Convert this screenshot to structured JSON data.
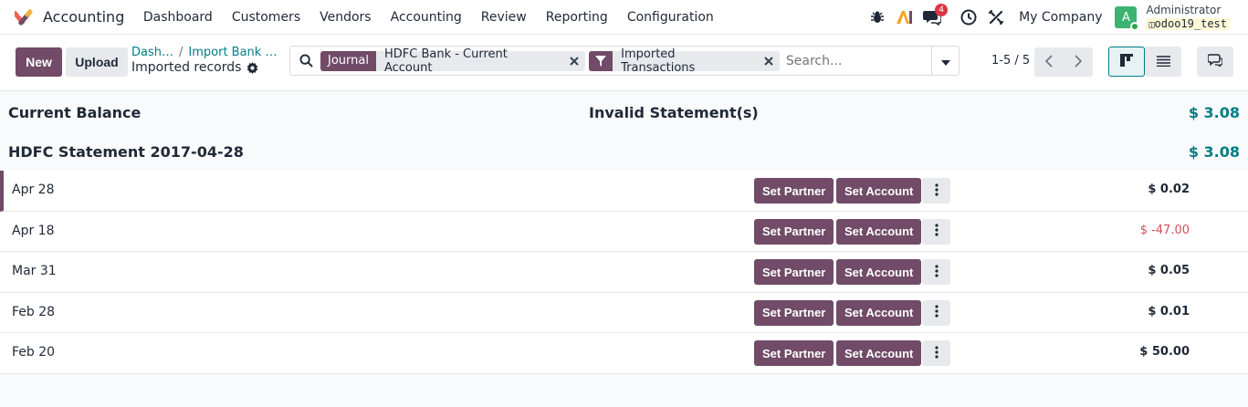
{
  "navbar": {
    "app_name": "Accounting",
    "menu": [
      "Dashboard",
      "Customers",
      "Vendors",
      "Accounting",
      "Review",
      "Reporting",
      "Configuration"
    ],
    "messages_badge": "4",
    "company": "My Company",
    "avatar_letter": "A",
    "user_name": "Administrator",
    "db_name": "odoo19_test"
  },
  "control": {
    "new_label": "New",
    "upload_label": "Upload",
    "breadcrumb": [
      "Dash…",
      "Import Bank …"
    ],
    "current": "Imported records",
    "facets": [
      {
        "label": "Journal",
        "value": "HDFC Bank - Current Account"
      },
      {
        "label": "",
        "value": "Imported Transactions"
      }
    ],
    "search_placeholder": "Search...",
    "pager": "1-5 / 5"
  },
  "content": {
    "balance_label": "Current Balance",
    "invalid_label": "Invalid Statement(s)",
    "balance_value": "$ 3.08",
    "statement_label": "HDFC Statement 2017-04-28",
    "statement_value": "$ 3.08",
    "set_partner": "Set Partner",
    "set_account": "Set Account",
    "lines": [
      {
        "date": "Apr 28",
        "amount": "$ 0.02"
      },
      {
        "date": "Apr 18",
        "amount": "$ -47.00"
      },
      {
        "date": "Mar 31",
        "amount": "$ 0.05"
      },
      {
        "date": "Feb 28",
        "amount": "$ 0.01"
      },
      {
        "date": "Feb 20",
        "amount": "$ 50.00"
      }
    ]
  },
  "colors": {
    "primary": "#714b67",
    "teal": "#017e84",
    "negative": "#d44c59",
    "badge": "#dc3545",
    "avatar": "#3cb371"
  }
}
